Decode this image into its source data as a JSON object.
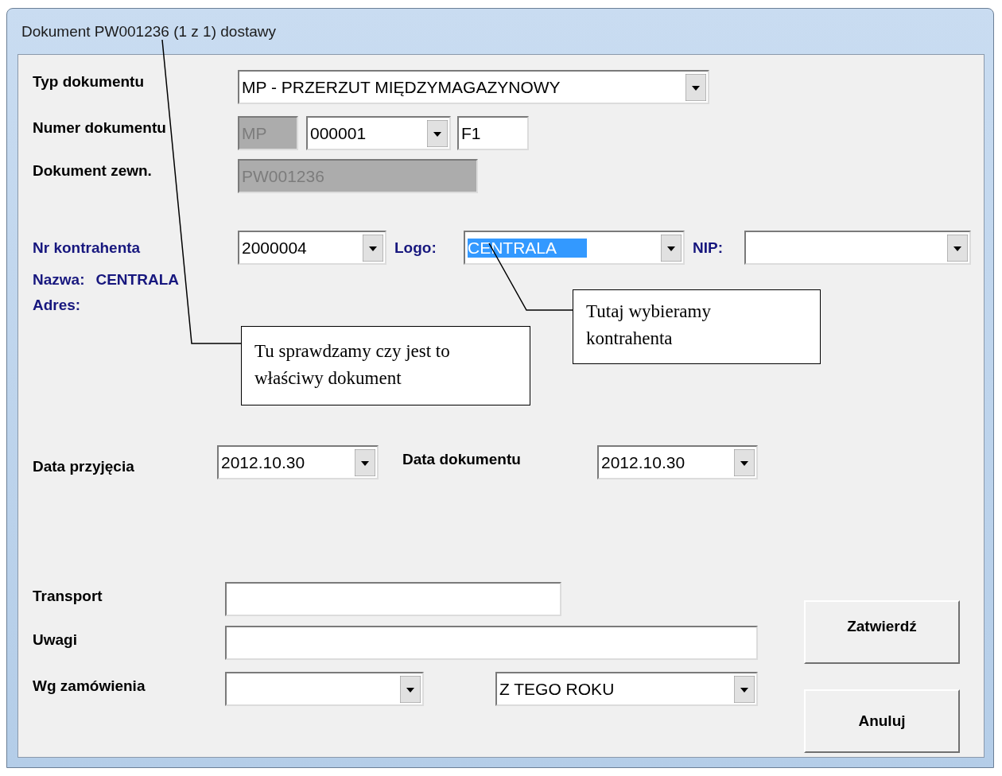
{
  "window": {
    "title": "Dokument PW001236 (1 z 1) dostawy"
  },
  "document_type": {
    "label": "Typ dokumentu",
    "value": "MP - PRZERZUT MIĘDZYMAGAZYNOWY"
  },
  "document_number": {
    "label": "Numer dokumentu",
    "prefix": {
      "value": "MP",
      "disabled": true
    },
    "number": "000001",
    "suffix": "F1"
  },
  "external_document": {
    "label": "Dokument zewn.",
    "value": "PW001236",
    "disabled": true
  },
  "contractor": {
    "label": "Nr kontrahenta",
    "number": "2000004",
    "logo_label": "Logo:",
    "logo": "CENTRALA",
    "logo_highlighted": true,
    "nip_label": "NIP:"
  },
  "name": {
    "label": "Nazwa:",
    "value": "CENTRALA"
  },
  "address": {
    "label": "Adres:"
  },
  "dates": {
    "received_label": "Data przyjęcia",
    "received": "2012.10.30",
    "document_label": "Data dokumentu",
    "document": "2012.10.30"
  },
  "transport": {
    "label": "Transport"
  },
  "notes": {
    "label": "Uwagi"
  },
  "order": {
    "label": "Wg zamówienia",
    "range": "Z TEGO ROKU"
  },
  "buttons": [
    "Zatwierdź",
    "Anuluj"
  ],
  "callouts": [
    {
      "text": "Tu sprawdzamy czy jest to właściwy dokument"
    },
    {
      "text": "Tutaj wybieramy kontrahenta"
    }
  ]
}
